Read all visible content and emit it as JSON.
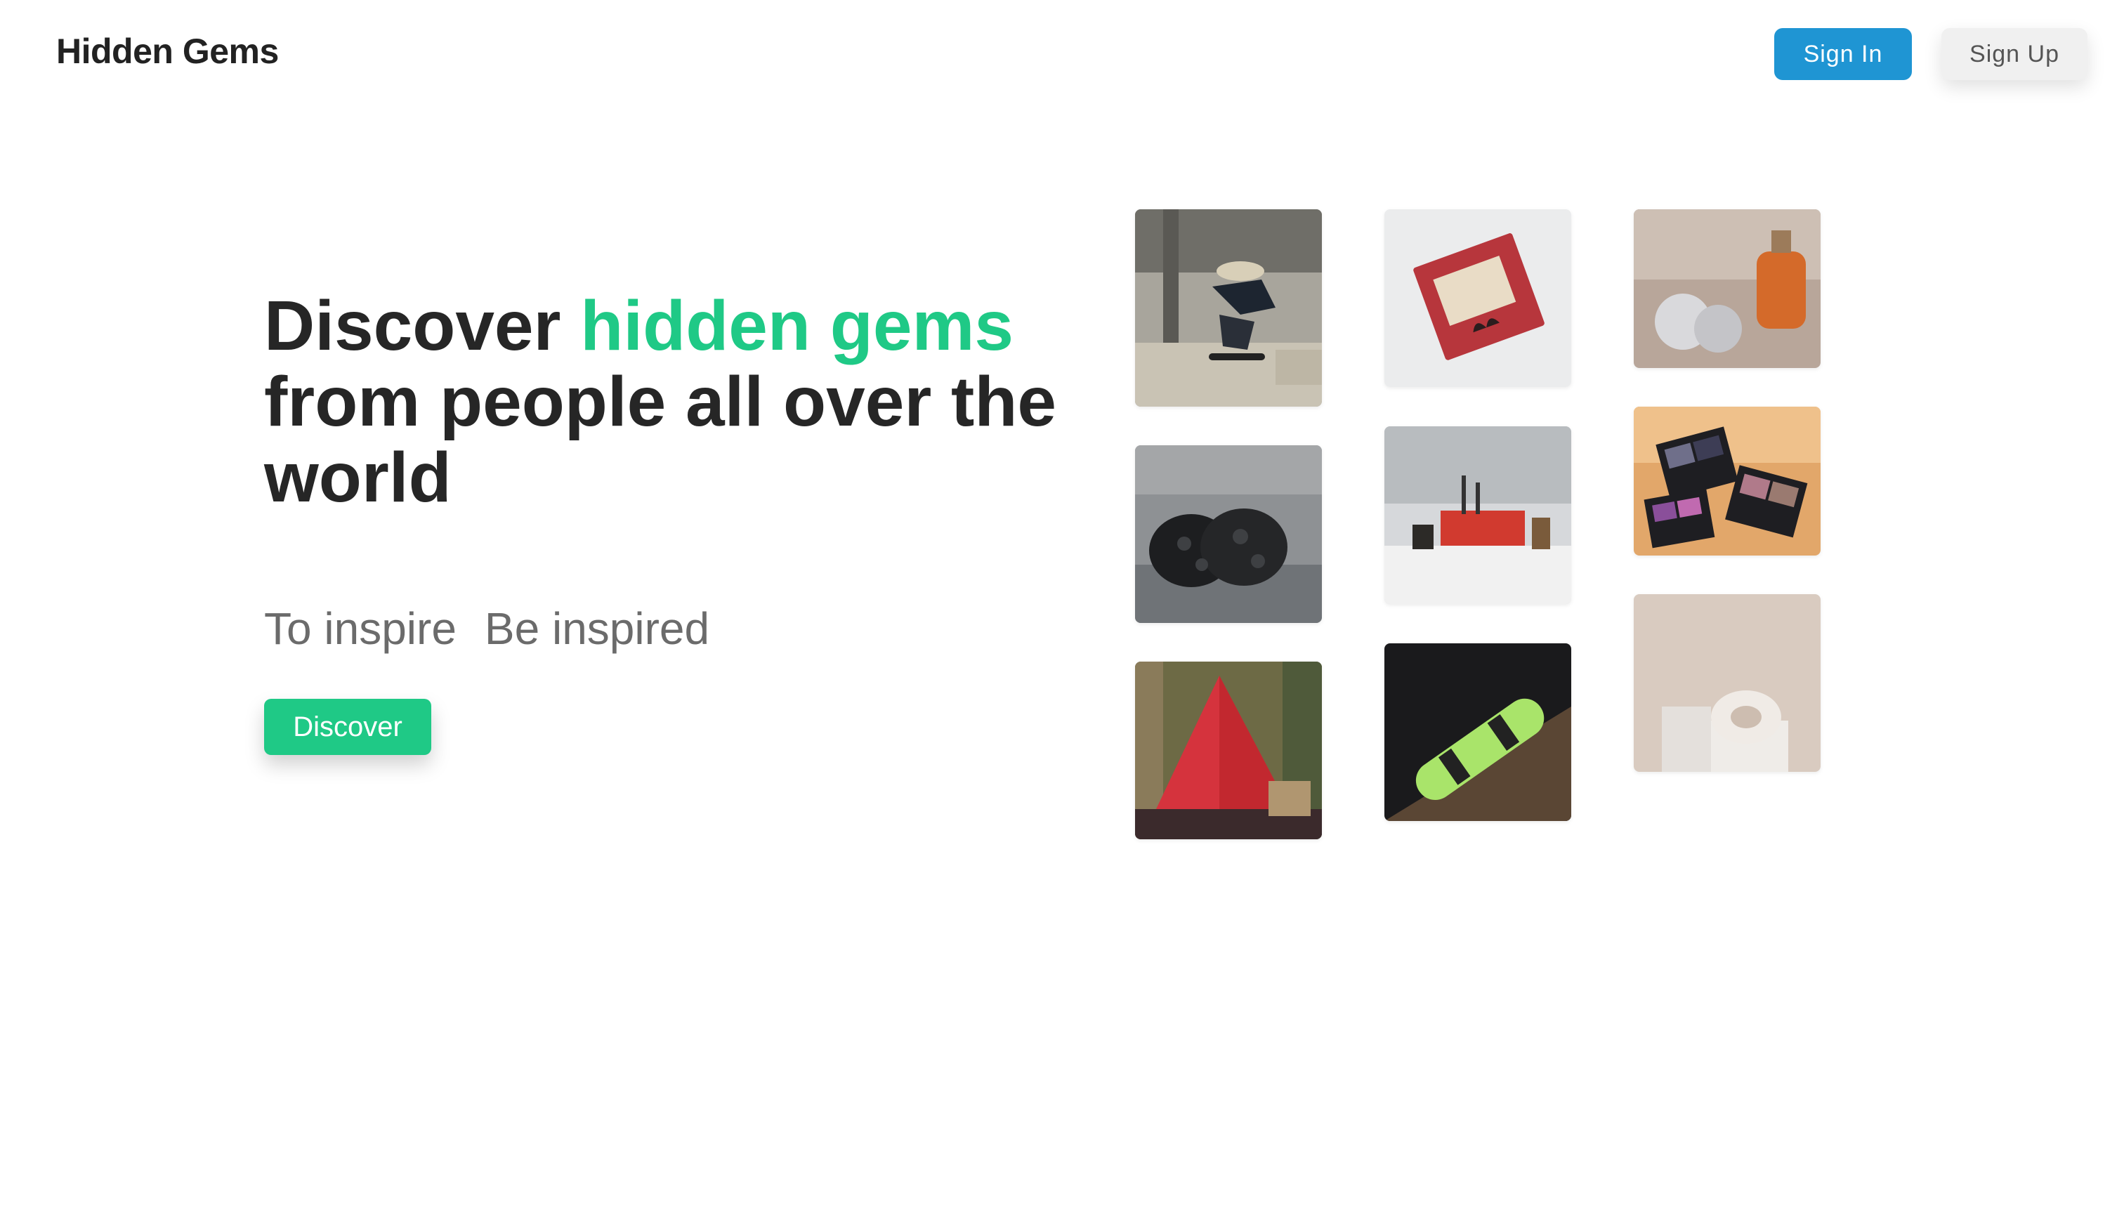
{
  "header": {
    "logo": "Hidden Gems",
    "sign_in_label": "Sign In",
    "sign_up_label": "Sign Up"
  },
  "hero": {
    "headline_part1": "Discover ",
    "headline_accent": "hidden gems",
    "headline_part2": "from people all over the world",
    "tagline_1": "To inspire",
    "tagline_2": "Be inspired",
    "cta_label": "Discover"
  },
  "colors": {
    "accent_green": "#1fc986",
    "primary_blue": "#1f95d3",
    "text_dark": "#262626",
    "text_muted": "#6b6b6b"
  },
  "gallery": [
    {
      "subject": "skateboarder-jump"
    },
    {
      "subject": "black-foam-shoes"
    },
    {
      "subject": "red-tent"
    },
    {
      "subject": "red-notebook"
    },
    {
      "subject": "makeup-desk"
    },
    {
      "subject": "green-wakeboard"
    },
    {
      "subject": "perfume-bottle"
    },
    {
      "subject": "eyeshadow-palettes"
    },
    {
      "subject": "ceramic-ring-vase"
    }
  ]
}
